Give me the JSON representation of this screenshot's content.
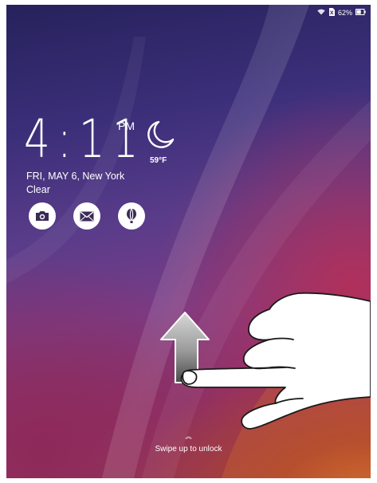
{
  "status_bar": {
    "wifi_icon": "wifi-icon",
    "sim_icon": "no-sim-icon",
    "battery_text": "62%",
    "battery_level": 0.62,
    "battery_icon": "battery-icon"
  },
  "clock": {
    "time": "4:11",
    "ampm": "PM",
    "weather_icon": "moon-icon",
    "temperature": "59°F",
    "date_line": "FRI, MAY 6, New York",
    "condition": "Clear"
  },
  "shortcuts": [
    {
      "name": "camera",
      "icon": "camera-icon"
    },
    {
      "name": "mail",
      "icon": "mail-icon"
    },
    {
      "name": "weather",
      "icon": "balloon-icon"
    }
  ],
  "unlock": {
    "chevron": "︽",
    "label": "Swipe up to unlock"
  },
  "illustration": {
    "arrow_icon": "up-arrow-icon",
    "hand_icon": "hand-swipe-icon"
  }
}
